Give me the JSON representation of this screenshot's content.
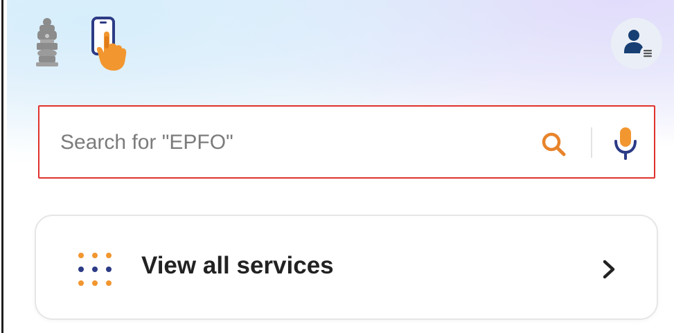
{
  "header": {
    "emblem_icon": "national-emblem-icon",
    "logo_icon": "app-logo-icon",
    "profile_icon": "profile-menu-icon"
  },
  "search": {
    "placeholder": "Search for \"EPFO\"",
    "value": "",
    "search_icon": "search-icon",
    "mic_icon": "microphone-icon",
    "highlight_color": "#e0312c",
    "accent_color": "#e8842b"
  },
  "services": {
    "label": "View all services",
    "grid_icon": "grid-icon",
    "chevron_icon": "chevron-right-icon"
  },
  "colors": {
    "orange": "#f2962f",
    "blue": "#2c3b85",
    "profile_blue": "#173f74"
  }
}
